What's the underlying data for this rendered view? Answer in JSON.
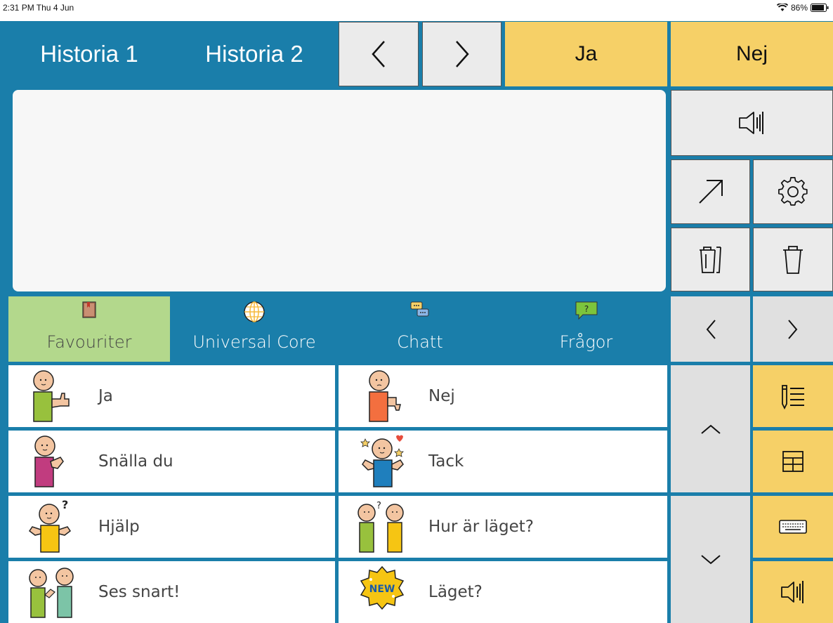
{
  "status": {
    "time": "2:31 PM  Thu 4 Jun",
    "battery": "86%"
  },
  "top_bar": {
    "history1": "Historia 1",
    "history2": "Historia 2",
    "yes": "Ja",
    "no": "Nej"
  },
  "tabs": {
    "favourites": "Favouriter",
    "universal_core": "Universal Core",
    "chat": "Chatt",
    "questions": "Frågor"
  },
  "phrases": [
    {
      "label": "Ja",
      "icon": "thumbs-up-person-icon"
    },
    {
      "label": "Nej",
      "icon": "thumbs-down-person-icon"
    },
    {
      "label": "Snälla du",
      "icon": "please-person-icon"
    },
    {
      "label": "Tack",
      "icon": "thank-you-person-icon"
    },
    {
      "label": "Hjälp",
      "icon": "help-person-icon"
    },
    {
      "label": "Hur är läget?",
      "icon": "how-are-you-icon"
    },
    {
      "label": "Ses snart!",
      "icon": "see-you-soon-icon"
    },
    {
      "label": "Läget?",
      "icon": "new-badge-icon"
    }
  ],
  "colors": {
    "brand_blue": "#1a7eaa",
    "yellow": "#f6d067",
    "green": "#b3d88c",
    "grey": "#ebebeb"
  }
}
